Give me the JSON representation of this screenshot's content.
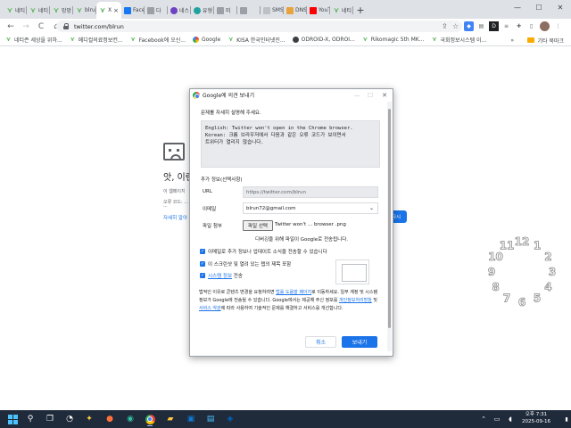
{
  "browser": {
    "tabs": [
      {
        "label": "네티",
        "favicon": "v"
      },
      {
        "label": "네티",
        "favicon": "v"
      },
      {
        "label": "망망",
        "favicon": "v"
      },
      {
        "label": "blru",
        "favicon": "v"
      },
      {
        "label": "X",
        "favicon": "v",
        "active": true
      },
      {
        "label": "Facel",
        "favicon": "blue"
      },
      {
        "label": "다",
        "favicon": "square"
      },
      {
        "label": "네스",
        "favicon": "purple"
      },
      {
        "label": "유형",
        "favicon": "teal"
      },
      {
        "label": "미",
        "favicon": "square"
      },
      {
        "label": "",
        "favicon": "square"
      },
      {
        "label": "SMS",
        "favicon": "gray"
      },
      {
        "label": "DNS",
        "favicon": "stripe"
      },
      {
        "label": "YouT",
        "favicon": "red"
      },
      {
        "label": "네티",
        "favicon": "v"
      }
    ],
    "new_tab_label": "+",
    "tab_close": "×",
    "url": "twitter.com/blrun",
    "nav": {
      "back": "←",
      "forward": "→",
      "reload": "C",
      "home": "⌂"
    },
    "window_controls": {
      "minimize": "—",
      "maximize": "☐",
      "close": "✕"
    },
    "bookmarks": [
      {
        "label": "네티즌 세상을 위하...",
        "favicon": "v"
      },
      {
        "label": "메디컬의료정보컨...",
        "favicon": "v"
      },
      {
        "label": "Facebook에 오신...",
        "favicon": "v"
      },
      {
        "label": "Google",
        "favicon": "g"
      },
      {
        "label": "KISA 한국인터넷진...",
        "favicon": "v"
      },
      {
        "label": "ODROID-X, ODROI...",
        "favicon": "o"
      },
      {
        "label": "Rikomagic 5th MK...",
        "favicon": "v"
      },
      {
        "label": "국회정보시스템 이...",
        "favicon": "v"
      }
    ],
    "bookmarks_overflow": "»",
    "other_bookmarks": "기타 북마크"
  },
  "page": {
    "error_title": "앗, 이런",
    "error_line1": "이 웹페이지",
    "error_line2": "오류 코드: ...",
    "error_line3": "...",
    "details_link": "자세히 알아",
    "reload_btn": "다시"
  },
  "dialog": {
    "title": "Google에 의견 보내기",
    "describe_label": "문제를 자세히 설명해 주세요.",
    "description": "English: Twitter won't open in the Chrome browser.\nKorean: 크롬 브라우저에서 다음과 같은 오류 코드가 보이면서\n트위터가 열리지 않습니다.",
    "extra_label": "추가 정보(선택사항)",
    "url_label": "URL",
    "url_value": "https://twitter.com/blrun",
    "email_label": "이메일",
    "email_value": "blrun72@gmail.com",
    "attach_label": "파일 첨부",
    "file_button": "파일 선택",
    "file_name": "Twitter won't ... browser .png",
    "diag_note": "디버깅을 위해 파일이 Google로 전송됩니다.",
    "check_email": "이메일로 추가 정보나 업데이트 소식을 전송할 수 있습니다",
    "check_screenshot": "이 스크린샷 및 열려 있는 탭의 제목 포함",
    "check_sysinfo_link": "시스템 정보",
    "check_sysinfo_rest": " 전송",
    "legal_text_1": "법적인 이유로 콘텐츠 변경을 요청하려면 ",
    "legal_link_1": "법률 도움말 페이지",
    "legal_text_2": "로 이동하세요. 일부 계정 및 시스템 정보가 Google에 전송될 수 있습니다. Google에서는 제공해 주신 정보를 ",
    "legal_link_2": "개인정보처리방침",
    "legal_text_3": " 및 ",
    "legal_link_3": "서비스 약관",
    "legal_text_4": "에 따라 사용하여 기술적인 문제를 해결하고 서비스를 개선합니다.",
    "cancel": "취소",
    "send": "보내기"
  },
  "clock_widget": {
    "numerals": [
      "12",
      "1",
      "2",
      "3",
      "4",
      "5",
      "6",
      "7",
      "8",
      "9",
      "10",
      "11"
    ]
  },
  "taskbar": {
    "time": "오후 7:31",
    "date": "2025-09-16"
  }
}
